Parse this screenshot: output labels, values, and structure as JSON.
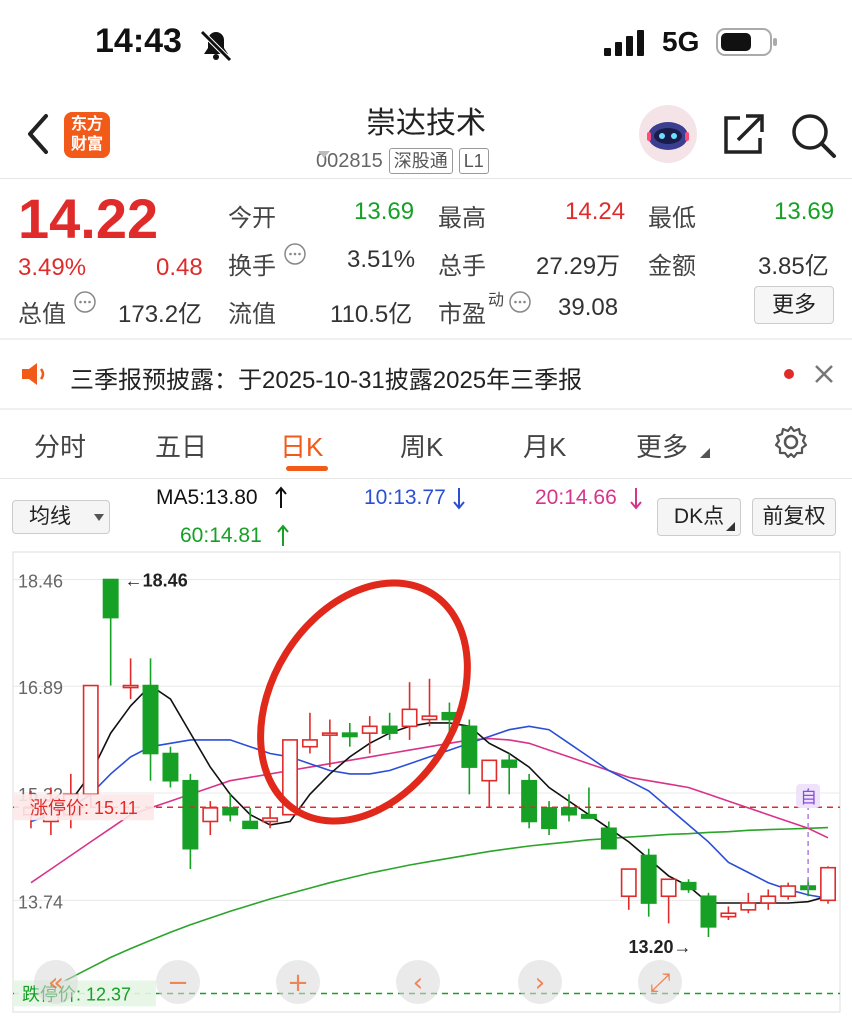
{
  "status_bar": {
    "time": "14:43",
    "network": "5G"
  },
  "header": {
    "title": "崇达技术",
    "code": "002815",
    "tag1": "深股通",
    "tag2": "L1",
    "logo_line1": "东方",
    "logo_line2": "财富"
  },
  "quote": {
    "price": "14.22",
    "change_pct": "3.49%",
    "change": "0.48",
    "market_cap_label": "总值",
    "market_cap": "173.2亿",
    "float_cap_label": "流值",
    "float_cap": "110.5亿",
    "open_label": "今开",
    "open": "13.69",
    "high_label": "最高",
    "high": "14.24",
    "low_label": "最低",
    "low": "13.69",
    "turnover_label": "换手",
    "turnover": "3.51%",
    "volume_label": "总手",
    "volume": "27.29万",
    "amount_label": "金额",
    "amount": "3.85亿",
    "pe_label": "市盈",
    "pe_sup": "动",
    "pe": "39.08",
    "more_button": "更多"
  },
  "notice": {
    "text": "三季报预披露：于2025-10-31披露2025年三季报"
  },
  "tabs": [
    {
      "label": "分时"
    },
    {
      "label": "五日"
    },
    {
      "label": "日K"
    },
    {
      "label": "周K"
    },
    {
      "label": "月K"
    },
    {
      "label": "更多"
    }
  ],
  "chart_toolbar": {
    "indicator_select": "均线",
    "ma5": "MA5:13.80",
    "ma10": "10:13.77",
    "ma20": "20:14.66",
    "ma60": "60:14.81",
    "dk_button": "DK点",
    "adjust_button": "前复权"
  },
  "colors": {
    "up": "#e02b2b",
    "down": "#16a025",
    "accent": "#f25a1a",
    "ma5": "#111111",
    "ma10": "#2a4fd6",
    "ma20": "#d8338a",
    "ma60": "#2aa52a"
  },
  "chart_data": {
    "type": "candlestick",
    "y_ticks": [
      "18.46",
      "16.89",
      "15.32",
      "13.74"
    ],
    "ylim": [
      12.2,
      18.6
    ],
    "annotations": {
      "max_label": "18.46",
      "min_label": "13.20",
      "limit_up": "涨停价: 15.11",
      "limit_down": "跌停价: 12.37",
      "self_select_marker": "自"
    },
    "candles": [
      {
        "o": 15.0,
        "h": 15.35,
        "l": 14.8,
        "c": 15.1
      },
      {
        "o": 14.9,
        "h": 15.4,
        "l": 14.7,
        "c": 15.2
      },
      {
        "o": 15.0,
        "h": 15.6,
        "l": 14.8,
        "c": 15.3
      },
      {
        "o": 15.3,
        "h": 16.9,
        "l": 15.1,
        "c": 16.9
      },
      {
        "o": 18.46,
        "h": 18.46,
        "l": 16.9,
        "c": 17.9
      },
      {
        "o": 16.9,
        "h": 17.3,
        "l": 16.7,
        "c": 16.9
      },
      {
        "o": 16.9,
        "h": 17.3,
        "l": 15.5,
        "c": 15.9
      },
      {
        "o": 15.9,
        "h": 16.0,
        "l": 15.4,
        "c": 15.5
      },
      {
        "o": 15.5,
        "h": 15.6,
        "l": 14.2,
        "c": 14.5
      },
      {
        "o": 14.9,
        "h": 15.2,
        "l": 14.7,
        "c": 15.1
      },
      {
        "o": 15.1,
        "h": 15.3,
        "l": 14.9,
        "c": 15.0
      },
      {
        "o": 14.9,
        "h": 15.1,
        "l": 14.8,
        "c": 14.8
      },
      {
        "o": 14.9,
        "h": 15.1,
        "l": 14.8,
        "c": 14.95
      },
      {
        "o": 15.0,
        "h": 16.1,
        "l": 15.0,
        "c": 16.1
      },
      {
        "o": 16.0,
        "h": 16.5,
        "l": 15.9,
        "c": 16.1
      },
      {
        "o": 16.2,
        "h": 16.4,
        "l": 15.7,
        "c": 16.2
      },
      {
        "o": 16.2,
        "h": 16.35,
        "l": 16.0,
        "c": 16.15
      },
      {
        "o": 16.2,
        "h": 16.45,
        "l": 15.9,
        "c": 16.3
      },
      {
        "o": 16.3,
        "h": 16.5,
        "l": 16.1,
        "c": 16.2
      },
      {
        "o": 16.3,
        "h": 16.95,
        "l": 16.1,
        "c": 16.55
      },
      {
        "o": 16.4,
        "h": 17.0,
        "l": 16.3,
        "c": 16.45
      },
      {
        "o": 16.5,
        "h": 16.65,
        "l": 16.2,
        "c": 16.4
      },
      {
        "o": 16.3,
        "h": 16.4,
        "l": 15.3,
        "c": 15.7
      },
      {
        "o": 15.5,
        "h": 15.8,
        "l": 15.1,
        "c": 15.8
      },
      {
        "o": 15.8,
        "h": 15.9,
        "l": 15.3,
        "c": 15.7
      },
      {
        "o": 15.5,
        "h": 15.6,
        "l": 14.8,
        "c": 14.9
      },
      {
        "o": 15.1,
        "h": 15.2,
        "l": 14.7,
        "c": 14.8
      },
      {
        "o": 15.1,
        "h": 15.3,
        "l": 14.9,
        "c": 15.0
      },
      {
        "o": 15.0,
        "h": 15.4,
        "l": 14.95,
        "c": 14.95
      },
      {
        "o": 14.8,
        "h": 14.9,
        "l": 14.5,
        "c": 14.5
      },
      {
        "o": 13.8,
        "h": 14.2,
        "l": 13.6,
        "c": 14.2
      },
      {
        "o": 14.4,
        "h": 14.5,
        "l": 13.5,
        "c": 13.7
      },
      {
        "o": 13.8,
        "h": 14.05,
        "l": 13.4,
        "c": 14.05
      },
      {
        "o": 14.0,
        "h": 14.05,
        "l": 13.85,
        "c": 13.9
      },
      {
        "o": 13.8,
        "h": 13.85,
        "l": 13.2,
        "c": 13.35
      },
      {
        "o": 13.5,
        "h": 13.65,
        "l": 13.45,
        "c": 13.55
      },
      {
        "o": 13.6,
        "h": 13.85,
        "l": 13.55,
        "c": 13.7
      },
      {
        "o": 13.7,
        "h": 13.9,
        "l": 13.6,
        "c": 13.8
      },
      {
        "o": 13.8,
        "h": 14.0,
        "l": 13.75,
        "c": 13.95
      },
      {
        "o": 13.95,
        "h": 14.05,
        "l": 13.8,
        "c": 13.9
      },
      {
        "o": 13.74,
        "h": 14.24,
        "l": 13.69,
        "c": 14.22
      }
    ],
    "ma_series": [
      {
        "name": "MA5",
        "values": [
          15.05,
          15.1,
          15.2,
          15.6,
          16.2,
          16.6,
          16.9,
          16.7,
          16.2,
          15.7,
          15.3,
          15.0,
          14.85,
          14.9,
          15.3,
          15.6,
          15.85,
          16.05,
          16.2,
          16.3,
          16.35,
          16.35,
          16.3,
          16.05,
          15.9,
          15.7,
          15.4,
          15.2,
          15.0,
          14.8,
          14.6,
          14.35,
          14.1,
          13.95,
          13.7,
          13.7,
          13.7,
          13.7,
          13.7,
          13.72,
          13.8
        ]
      },
      {
        "name": "MA10",
        "values": [
          14.9,
          15.0,
          15.1,
          15.3,
          15.6,
          15.85,
          16.0,
          16.05,
          16.1,
          16.1,
          16.1,
          16.0,
          15.9,
          15.85,
          15.75,
          15.65,
          15.6,
          15.6,
          15.65,
          15.75,
          15.85,
          15.95,
          16.05,
          16.15,
          16.25,
          16.3,
          16.25,
          16.05,
          15.85,
          15.65,
          15.5,
          15.35,
          15.1,
          14.85,
          14.6,
          14.3,
          14.15,
          14.0,
          13.9,
          13.82,
          13.77
        ]
      },
      {
        "name": "MA20",
        "values": [
          14.0,
          14.2,
          14.4,
          14.6,
          14.8,
          15.0,
          15.1,
          15.2,
          15.3,
          15.4,
          15.5,
          15.55,
          15.6,
          15.65,
          15.7,
          15.75,
          15.8,
          15.85,
          15.9,
          15.95,
          16.0,
          16.05,
          16.1,
          16.12,
          16.1,
          16.05,
          15.95,
          15.85,
          15.75,
          15.65,
          15.55,
          15.5,
          15.45,
          15.4,
          15.3,
          15.2,
          15.1,
          15.0,
          14.9,
          14.8,
          14.66
        ]
      },
      {
        "name": "MA60",
        "values": [
          12.3,
          12.45,
          12.6,
          12.75,
          12.9,
          13.03,
          13.15,
          13.27,
          13.38,
          13.48,
          13.58,
          13.67,
          13.76,
          13.84,
          13.92,
          14.0,
          14.07,
          14.14,
          14.2,
          14.26,
          14.31,
          14.36,
          14.41,
          14.46,
          14.5,
          14.54,
          14.57,
          14.6,
          14.63,
          14.65,
          14.67,
          14.69,
          14.71,
          14.72,
          14.74,
          14.75,
          14.77,
          14.78,
          14.79,
          14.8,
          14.81
        ]
      }
    ]
  }
}
